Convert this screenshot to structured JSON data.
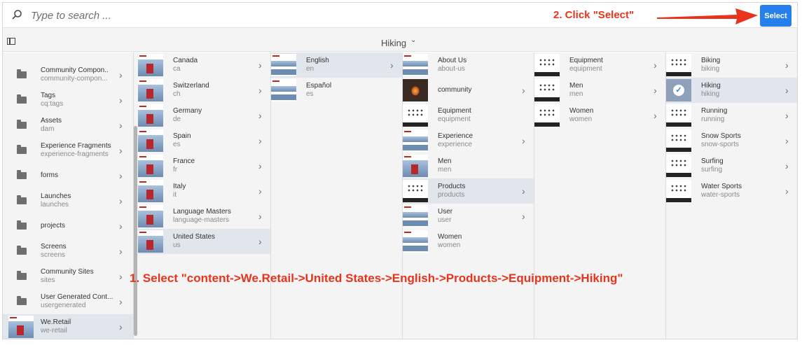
{
  "search": {
    "placeholder": "Type to search ..."
  },
  "select_button": {
    "label": "Select"
  },
  "annotations": {
    "step2": "2. Click \"Select\"",
    "step1": "1. Select \"content->We.Retail->United States->English->Products->Equipment->Hiking\""
  },
  "toolbar": {
    "breadcrumb": "Hiking"
  },
  "colors": {
    "accent": "#2680eb",
    "annotation": "#e8341c",
    "selected_row": "#e1e5ec"
  },
  "columns": [
    {
      "items": [
        {
          "title": "Community Compon..",
          "sub": "community-compon...",
          "icon": "folder-icon"
        },
        {
          "title": "Tags",
          "sub": "cq:tags",
          "icon": "folder-icon"
        },
        {
          "title": "Assets",
          "sub": "dam",
          "icon": "folder-icon"
        },
        {
          "title": "Experience Fragments",
          "sub": "experience-fragments",
          "icon": "folder-icon"
        },
        {
          "title": "forms",
          "sub": "",
          "icon": "folder-icon"
        },
        {
          "title": "Launches",
          "sub": "launches",
          "icon": "folder-icon"
        },
        {
          "title": "projects",
          "sub": "",
          "icon": "folder-icon"
        },
        {
          "title": "Screens",
          "sub": "screens",
          "icon": "folder-icon"
        },
        {
          "title": "Community Sites",
          "sub": "sites",
          "icon": "folder-icon"
        },
        {
          "title": "User Generated Cont...",
          "sub": "usergenerated",
          "icon": "folder-icon"
        },
        {
          "title": "We.Retail",
          "sub": "we-retail",
          "icon": "page-thumbnail",
          "selected": true
        }
      ]
    },
    {
      "items": [
        {
          "title": "Canada",
          "sub": "ca"
        },
        {
          "title": "Switzerland",
          "sub": "ch"
        },
        {
          "title": "Germany",
          "sub": "de"
        },
        {
          "title": "Spain",
          "sub": "es"
        },
        {
          "title": "France",
          "sub": "fr"
        },
        {
          "title": "Italy",
          "sub": "it"
        },
        {
          "title": "Language Masters",
          "sub": "language-masters"
        },
        {
          "title": "United States",
          "sub": "us",
          "selected": true
        }
      ]
    },
    {
      "items": [
        {
          "title": "English",
          "sub": "en",
          "selected": true
        },
        {
          "title": "Español",
          "sub": "es"
        }
      ]
    },
    {
      "items": [
        {
          "title": "About Us",
          "sub": "about-us"
        },
        {
          "title": "community",
          "sub": ""
        },
        {
          "title": "Equipment",
          "sub": "equipment"
        },
        {
          "title": "Experience",
          "sub": "experience"
        },
        {
          "title": "Men",
          "sub": "men"
        },
        {
          "title": "Products",
          "sub": "products",
          "selected": true
        },
        {
          "title": "User",
          "sub": "user"
        },
        {
          "title": "Women",
          "sub": "women"
        }
      ]
    },
    {
      "items": [
        {
          "title": "Equipment",
          "sub": "equipment"
        },
        {
          "title": "Men",
          "sub": "men"
        },
        {
          "title": "Women",
          "sub": "women"
        }
      ]
    },
    {
      "items": [
        {
          "title": "Biking",
          "sub": "biking"
        },
        {
          "title": "Hiking",
          "sub": "hiking",
          "selected": true,
          "checked": true
        },
        {
          "title": "Running",
          "sub": "running"
        },
        {
          "title": "Snow Sports",
          "sub": "snow-sports"
        },
        {
          "title": "Surfing",
          "sub": "surfing"
        },
        {
          "title": "Water Sports",
          "sub": "water-sports"
        }
      ]
    }
  ]
}
